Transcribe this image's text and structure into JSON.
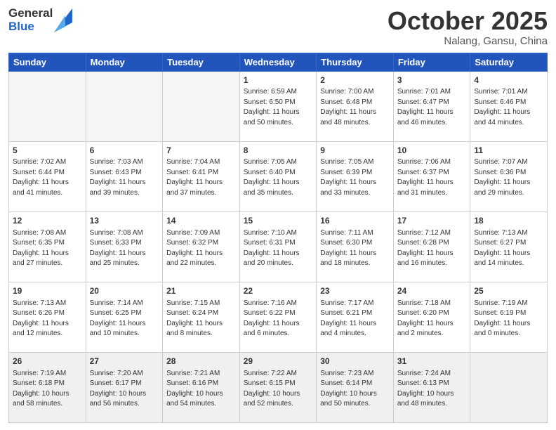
{
  "header": {
    "logo_general": "General",
    "logo_blue": "Blue",
    "month": "October 2025",
    "location": "Nalang, Gansu, China"
  },
  "weekdays": [
    "Sunday",
    "Monday",
    "Tuesday",
    "Wednesday",
    "Thursday",
    "Friday",
    "Saturday"
  ],
  "weeks": [
    [
      {
        "day": "",
        "empty": true
      },
      {
        "day": "",
        "empty": true
      },
      {
        "day": "",
        "empty": true
      },
      {
        "day": "1",
        "sunrise": "6:59 AM",
        "sunset": "6:50 PM",
        "daylight": "11 hours and 50 minutes."
      },
      {
        "day": "2",
        "sunrise": "7:00 AM",
        "sunset": "6:48 PM",
        "daylight": "11 hours and 48 minutes."
      },
      {
        "day": "3",
        "sunrise": "7:01 AM",
        "sunset": "6:47 PM",
        "daylight": "11 hours and 46 minutes."
      },
      {
        "day": "4",
        "sunrise": "7:01 AM",
        "sunset": "6:46 PM",
        "daylight": "11 hours and 44 minutes."
      }
    ],
    [
      {
        "day": "5",
        "sunrise": "7:02 AM",
        "sunset": "6:44 PM",
        "daylight": "11 hours and 41 minutes."
      },
      {
        "day": "6",
        "sunrise": "7:03 AM",
        "sunset": "6:43 PM",
        "daylight": "11 hours and 39 minutes."
      },
      {
        "day": "7",
        "sunrise": "7:04 AM",
        "sunset": "6:41 PM",
        "daylight": "11 hours and 37 minutes."
      },
      {
        "day": "8",
        "sunrise": "7:05 AM",
        "sunset": "6:40 PM",
        "daylight": "11 hours and 35 minutes."
      },
      {
        "day": "9",
        "sunrise": "7:05 AM",
        "sunset": "6:39 PM",
        "daylight": "11 hours and 33 minutes."
      },
      {
        "day": "10",
        "sunrise": "7:06 AM",
        "sunset": "6:37 PM",
        "daylight": "11 hours and 31 minutes."
      },
      {
        "day": "11",
        "sunrise": "7:07 AM",
        "sunset": "6:36 PM",
        "daylight": "11 hours and 29 minutes."
      }
    ],
    [
      {
        "day": "12",
        "sunrise": "7:08 AM",
        "sunset": "6:35 PM",
        "daylight": "11 hours and 27 minutes."
      },
      {
        "day": "13",
        "sunrise": "7:08 AM",
        "sunset": "6:33 PM",
        "daylight": "11 hours and 25 minutes."
      },
      {
        "day": "14",
        "sunrise": "7:09 AM",
        "sunset": "6:32 PM",
        "daylight": "11 hours and 22 minutes."
      },
      {
        "day": "15",
        "sunrise": "7:10 AM",
        "sunset": "6:31 PM",
        "daylight": "11 hours and 20 minutes."
      },
      {
        "day": "16",
        "sunrise": "7:11 AM",
        "sunset": "6:30 PM",
        "daylight": "11 hours and 18 minutes."
      },
      {
        "day": "17",
        "sunrise": "7:12 AM",
        "sunset": "6:28 PM",
        "daylight": "11 hours and 16 minutes."
      },
      {
        "day": "18",
        "sunrise": "7:13 AM",
        "sunset": "6:27 PM",
        "daylight": "11 hours and 14 minutes."
      }
    ],
    [
      {
        "day": "19",
        "sunrise": "7:13 AM",
        "sunset": "6:26 PM",
        "daylight": "11 hours and 12 minutes."
      },
      {
        "day": "20",
        "sunrise": "7:14 AM",
        "sunset": "6:25 PM",
        "daylight": "11 hours and 10 minutes."
      },
      {
        "day": "21",
        "sunrise": "7:15 AM",
        "sunset": "6:24 PM",
        "daylight": "11 hours and 8 minutes."
      },
      {
        "day": "22",
        "sunrise": "7:16 AM",
        "sunset": "6:22 PM",
        "daylight": "11 hours and 6 minutes."
      },
      {
        "day": "23",
        "sunrise": "7:17 AM",
        "sunset": "6:21 PM",
        "daylight": "11 hours and 4 minutes."
      },
      {
        "day": "24",
        "sunrise": "7:18 AM",
        "sunset": "6:20 PM",
        "daylight": "11 hours and 2 minutes."
      },
      {
        "day": "25",
        "sunrise": "7:19 AM",
        "sunset": "6:19 PM",
        "daylight": "11 hours and 0 minutes."
      }
    ],
    [
      {
        "day": "26",
        "sunrise": "7:19 AM",
        "sunset": "6:18 PM",
        "daylight": "10 hours and 58 minutes.",
        "last": true
      },
      {
        "day": "27",
        "sunrise": "7:20 AM",
        "sunset": "6:17 PM",
        "daylight": "10 hours and 56 minutes.",
        "last": true
      },
      {
        "day": "28",
        "sunrise": "7:21 AM",
        "sunset": "6:16 PM",
        "daylight": "10 hours and 54 minutes.",
        "last": true
      },
      {
        "day": "29",
        "sunrise": "7:22 AM",
        "sunset": "6:15 PM",
        "daylight": "10 hours and 52 minutes.",
        "last": true
      },
      {
        "day": "30",
        "sunrise": "7:23 AM",
        "sunset": "6:14 PM",
        "daylight": "10 hours and 50 minutes.",
        "last": true
      },
      {
        "day": "31",
        "sunrise": "7:24 AM",
        "sunset": "6:13 PM",
        "daylight": "10 hours and 48 minutes.",
        "last": true
      },
      {
        "day": "",
        "empty": true,
        "last": true
      }
    ]
  ]
}
